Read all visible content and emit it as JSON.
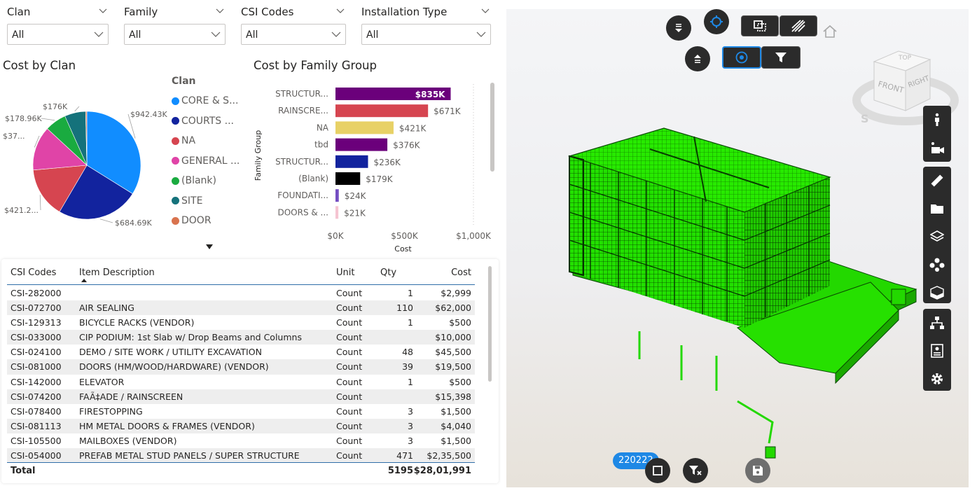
{
  "slicers": [
    {
      "title": "Clan",
      "value": "All"
    },
    {
      "title": "Family",
      "value": "All"
    },
    {
      "title": "CSI Codes",
      "value": "All"
    },
    {
      "title": "Installation Type",
      "value": "All"
    }
  ],
  "pie": {
    "title": "Cost by Clan",
    "legend_title": "Clan",
    "slices": [
      {
        "name": "CORE & S...",
        "value": 942.43,
        "label": "$942.43K",
        "color": "#118DFF"
      },
      {
        "name": "COURTS ...",
        "value": 684.69,
        "label": "$684.69K",
        "color": "#12239E"
      },
      {
        "name": "NA",
        "value": 421.2,
        "label": "$421.2...",
        "color": "#D64550"
      },
      {
        "name": "GENERAL ...",
        "value": 370,
        "label": "$37...",
        "color": "#E044A7"
      },
      {
        "name": "(Blank)",
        "value": 178.96,
        "label": "$178.96K",
        "color": "#1AAB40"
      },
      {
        "name": "SITE",
        "value": 176,
        "label": "$176K",
        "color": "#15727B"
      },
      {
        "name": "DOOR",
        "value": 10,
        "label": "",
        "color": "#D9734E"
      }
    ]
  },
  "chart_data": {
    "type": "bar",
    "orientation": "horizontal",
    "title": "Cost by Family Group",
    "xlabel": "Cost",
    "ylabel": "Family Group",
    "xlim": [
      0,
      1000
    ],
    "xticks": [
      "$0K",
      "$500K",
      "$1,000K"
    ],
    "categories": [
      "STRUCTUR...",
      "RAINSCRE...",
      "NA",
      "tbd",
      "STRUCTUR...",
      "(Blank)",
      "FOUNDATI...",
      "DOORS & ..."
    ],
    "values": [
      835,
      671,
      421,
      376,
      236,
      179,
      24,
      21
    ],
    "labels": [
      "$835K",
      "$671K",
      "$421K",
      "$376K",
      "$236K",
      "$179K",
      "$24K",
      "$21K"
    ],
    "colors": [
      "#6B007B",
      "#D64550",
      "#E8D166",
      "#6B007B",
      "#12239E",
      "#000000",
      "#744EC2",
      "#F5C4D1"
    ],
    "grid": false
  },
  "table": {
    "headers": {
      "code": "CSI Codes",
      "desc": "Item Description",
      "unit": "Unit",
      "qty": "Qty",
      "cost": "Cost"
    },
    "rows": [
      {
        "code": "CSI-282000",
        "desc": "",
        "unit": "Count",
        "qty": "1",
        "cost": "$2,999"
      },
      {
        "code": "CSI-072700",
        "desc": "AIR SEALING",
        "unit": "Count",
        "qty": "110",
        "cost": "$62,000"
      },
      {
        "code": "CSI-129313",
        "desc": "BICYCLE RACKS (VENDOR)",
        "unit": "Count",
        "qty": "1",
        "cost": "$500"
      },
      {
        "code": "CSI-033000",
        "desc": "CIP PODIUM: 1st Slab w/ Drop Beams and Columns",
        "unit": "Count",
        "qty": "",
        "cost": "$10,000"
      },
      {
        "code": "CSI-024100",
        "desc": "DEMO / SITE WORK / UTILITY EXCAVATION",
        "unit": "Count",
        "qty": "48",
        "cost": "$45,500"
      },
      {
        "code": "CSI-081000",
        "desc": "DOORS (HM/WOOD/HARDWARE) (VENDOR)",
        "unit": "Count",
        "qty": "39",
        "cost": "$19,500"
      },
      {
        "code": "CSI-142000",
        "desc": "ELEVATOR",
        "unit": "Count",
        "qty": "1",
        "cost": "$500"
      },
      {
        "code": "CSI-074200",
        "desc": "FAÃ‡ADE / RAINSCREEN",
        "unit": "Count",
        "qty": "",
        "cost": "$15,398"
      },
      {
        "code": "CSI-078400",
        "desc": "FIRESTOPPING",
        "unit": "Count",
        "qty": "3",
        "cost": "$1,500"
      },
      {
        "code": "CSI-081113",
        "desc": "HM METAL DOORS & FRAMES (VENDOR)",
        "unit": "Count",
        "qty": "3",
        "cost": "$4,040"
      },
      {
        "code": "CSI-105500",
        "desc": "MAILBOXES (VENDOR)",
        "unit": "Count",
        "qty": "3",
        "cost": "$1,500"
      },
      {
        "code": "CSI-054000",
        "desc": "PREFAB METAL STUD PANELS / SUPER STRUCTURE",
        "unit": "Count",
        "qty": "471",
        "cost": "$2,35,500"
      }
    ],
    "total": {
      "label": "Total",
      "qty": "5195",
      "cost": "$28,01,991"
    }
  },
  "viewer": {
    "element_id": "220222",
    "viewcube": {
      "top": "TOP",
      "front": "FRONT",
      "right": "RIGHT",
      "compass": "S"
    },
    "model_color": "#22e000",
    "accent": "#1e88e5"
  }
}
